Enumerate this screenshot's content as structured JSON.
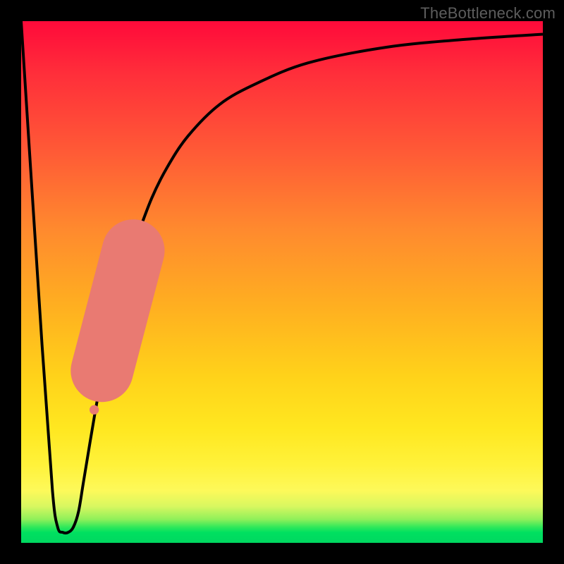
{
  "watermark": "TheBottleneck.com",
  "colors": {
    "frame": "#000000",
    "curve": "#000000",
    "dot": "#e97a72",
    "dot_stroke": "#d5665f"
  },
  "chart_data": {
    "type": "line",
    "title": "",
    "xlabel": "",
    "ylabel": "",
    "xlim": [
      0,
      100
    ],
    "ylim": [
      0,
      100
    ],
    "series": [
      {
        "name": "bottleneck-curve",
        "x": [
          0,
          4,
          6,
          7,
          8,
          9,
          10,
          11,
          12,
          14,
          16,
          18,
          20,
          22,
          25,
          28,
          32,
          38,
          45,
          55,
          70,
          85,
          100
        ],
        "y": [
          100,
          38,
          10,
          3,
          2,
          2,
          3,
          6,
          12,
          24,
          35,
          44,
          52,
          58,
          66,
          72,
          78,
          84,
          88,
          92,
          95,
          96.5,
          97.5
        ]
      }
    ],
    "overlay_segment": {
      "name": "highlight-band",
      "x": [
        15.5,
        21.5
      ],
      "y": [
        33,
        56
      ]
    },
    "overlay_dots": [
      {
        "x": 15.0,
        "y": 30.5,
        "r": 1.0
      },
      {
        "x": 14.5,
        "y": 28.0,
        "r": 0.9
      },
      {
        "x": 14.0,
        "y": 25.5,
        "r": 0.9
      }
    ]
  }
}
